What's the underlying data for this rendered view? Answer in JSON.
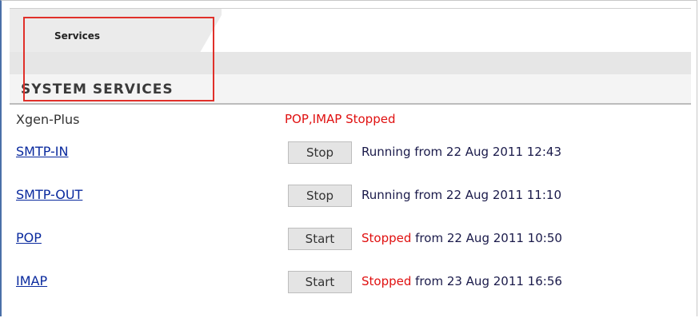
{
  "tabs": [
    {
      "label": "Services"
    }
  ],
  "section": {
    "title": "SYSTEM SERVICES"
  },
  "xgen": {
    "name": "Xgen-Plus",
    "status": "POP,IMAP Stopped"
  },
  "services": [
    {
      "name": "SMTP-IN",
      "button": "Stop",
      "state": "",
      "status_text": "Running from 22 Aug 2011 12:43"
    },
    {
      "name": "SMTP-OUT",
      "button": "Stop",
      "state": "",
      "status_text": "Running from 22 Aug 2011 11:10"
    },
    {
      "name": "POP",
      "button": "Start",
      "state": "Stopped",
      "status_text": " from 22 Aug 2011 10:50"
    },
    {
      "name": "IMAP",
      "button": "Start",
      "state": "Stopped",
      "status_text": " from 23 Aug 2011 16:56"
    }
  ],
  "colors": {
    "link": "#0a2a9e",
    "stopped": "#e01010",
    "highlight": "#e0302a"
  }
}
